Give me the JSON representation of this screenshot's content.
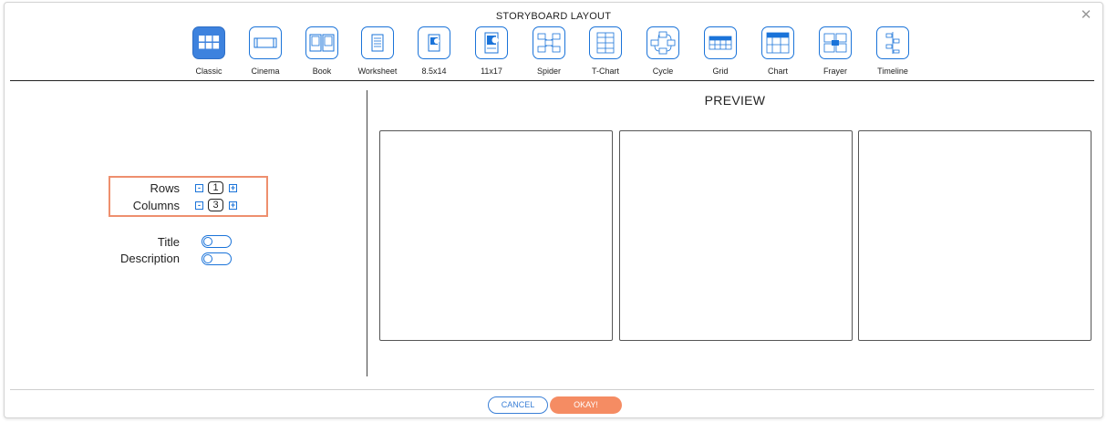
{
  "dialog": {
    "title": "STORYBOARD LAYOUT",
    "close_symbol": "✕"
  },
  "layouts": [
    {
      "label": "Classic",
      "icon": "classic-grid-icon",
      "active": true
    },
    {
      "label": "Cinema",
      "icon": "cinema-icon",
      "active": false
    },
    {
      "label": "Book",
      "icon": "book-icon",
      "active": false
    },
    {
      "label": "Worksheet",
      "icon": "worksheet-icon",
      "active": false
    },
    {
      "label": "8.5x14",
      "icon": "legal-page-icon",
      "active": false
    },
    {
      "label": "11x17",
      "icon": "tabloid-page-icon",
      "active": false
    },
    {
      "label": "Spider",
      "icon": "spider-map-icon",
      "active": false
    },
    {
      "label": "T-Chart",
      "icon": "t-chart-icon",
      "active": false
    },
    {
      "label": "Cycle",
      "icon": "cycle-icon",
      "active": false
    },
    {
      "label": "Grid",
      "icon": "grid-icon",
      "active": false
    },
    {
      "label": "Chart",
      "icon": "chart-icon",
      "active": false
    },
    {
      "label": "Frayer",
      "icon": "frayer-model-icon",
      "active": false
    },
    {
      "label": "Timeline",
      "icon": "timeline-icon",
      "active": false
    }
  ],
  "settings": {
    "rows_label": "Rows",
    "rows_value": "1",
    "columns_label": "Columns",
    "columns_value": "3",
    "minus_symbol": "-",
    "plus_symbol": "+",
    "title_label": "Title",
    "title_enabled": false,
    "description_label": "Description",
    "description_enabled": false
  },
  "preview": {
    "heading": "PREVIEW",
    "rows": 1,
    "columns": 3
  },
  "footer": {
    "cancel_label": "CANCEL",
    "okay_label": "OKAY!"
  },
  "colors": {
    "accent_blue": "#1a73d9",
    "active_blue": "#3d82de",
    "highlight_orange": "#ee8f6e",
    "okay_orange": "#f58c63"
  }
}
